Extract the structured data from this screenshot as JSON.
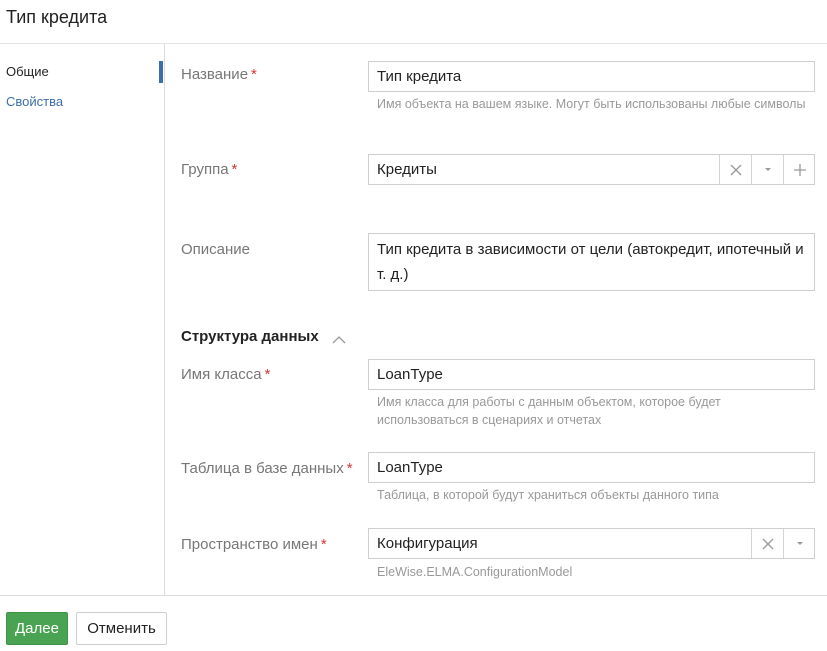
{
  "window": {
    "title": "Тип кредита"
  },
  "sidebar": {
    "items": [
      {
        "label": "Общие",
        "active": true
      },
      {
        "label": "Свойства",
        "active": false
      }
    ]
  },
  "form": {
    "name": {
      "label": "Название",
      "required_mark": "*",
      "value": "Тип кредита",
      "hint": "Имя объекта на вашем языке. Могут быть использованы любые символы"
    },
    "group": {
      "label": "Группа",
      "required_mark": "*",
      "value": "Кредиты",
      "icons": [
        "clear-icon",
        "chevron-down-icon",
        "plus-icon"
      ]
    },
    "description": {
      "label": "Описание",
      "value": "Тип кредита в зависимости от цели (автокредит, ипотечный и т. д.)"
    },
    "data_structure": {
      "title": "Структура данных",
      "icon": "chevron-up-icon",
      "class_name": {
        "label": "Имя класса",
        "required_mark": "*",
        "value": "LoanType",
        "hint": "Имя класса для работы с данным объектом, которое будет использоваться в сценариях и отчетах"
      },
      "db_table": {
        "label": "Таблица в базе данных",
        "required_mark": "*",
        "value": "LoanType",
        "hint": "Таблица, в которой будут храниться объекты данного типа"
      },
      "namespace": {
        "label": "Пространство имен",
        "required_mark": "*",
        "value": "Конфигурация",
        "hint": "EleWise.ELMA.ConfigurationModel",
        "icons": [
          "clear-icon",
          "chevron-down-icon"
        ]
      }
    }
  },
  "footer": {
    "next_label": "Далее",
    "cancel_label": "Отменить"
  },
  "colors": {
    "accent": "#3d6ea8",
    "primary_button": "#4aa352",
    "required": "#dd3333"
  }
}
